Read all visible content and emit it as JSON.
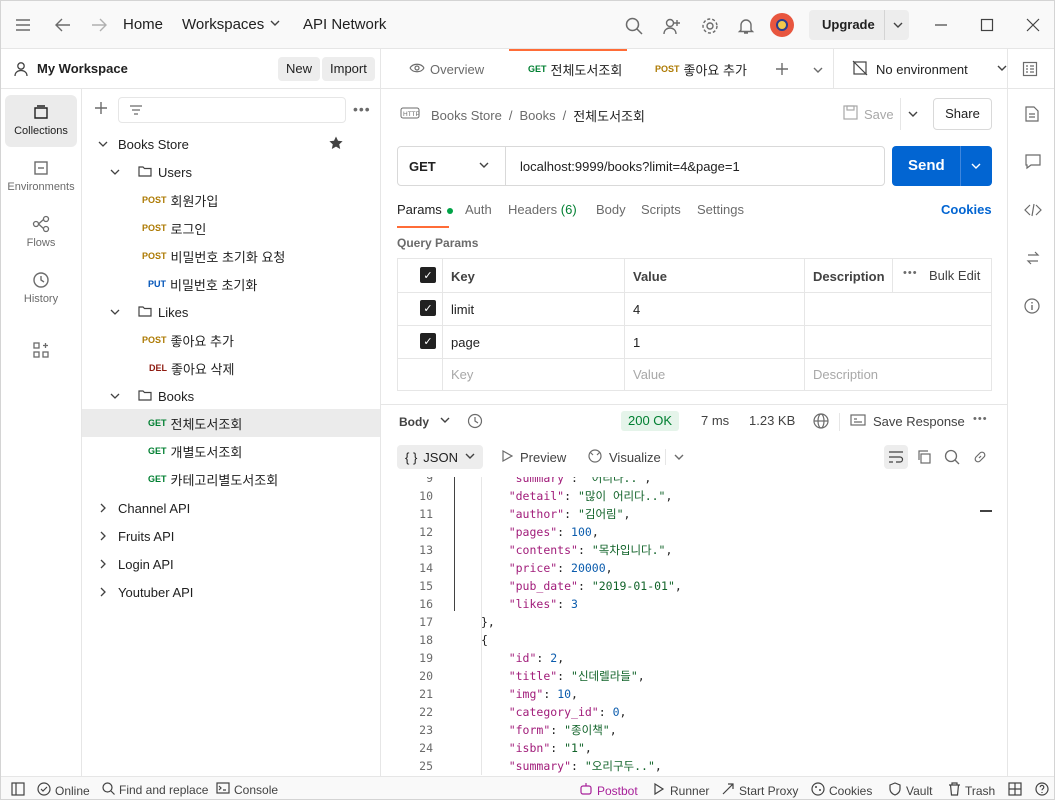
{
  "topbar": {
    "home": "Home",
    "workspaces": "Workspaces",
    "api_network": "API Network",
    "upgrade": "Upgrade"
  },
  "workspace": {
    "name": "My Workspace",
    "new": "New",
    "import": "Import"
  },
  "rail": {
    "items": [
      "Collections",
      "Environments",
      "Flows",
      "History"
    ]
  },
  "tree": {
    "collection": "Books Store",
    "folders": {
      "users": "Users",
      "likes": "Likes",
      "books": "Books"
    },
    "requests": [
      {
        "method": "POST",
        "name": "회원가입"
      },
      {
        "method": "POST",
        "name": "로그인"
      },
      {
        "method": "POST",
        "name": "비밀번호 초기화 요청"
      },
      {
        "method": "PUT",
        "name": "비밀번호 초기화"
      },
      {
        "method": "POST",
        "name": "좋아요 추가"
      },
      {
        "method": "DEL",
        "name": "좋아요 삭제"
      },
      {
        "method": "GET",
        "name": "전체도서조회"
      },
      {
        "method": "GET",
        "name": "개별도서조회"
      },
      {
        "method": "GET",
        "name": "카테고리별도서조회"
      }
    ],
    "other_collections": [
      "Channel API",
      "Fruits API",
      "Login API",
      "Youtuber API"
    ]
  },
  "tabs": {
    "overview": "Overview",
    "tab1_method": "GET",
    "tab1_name": "전체도서조회",
    "tab2_method": "POST",
    "tab2_name": "좋아요 추가",
    "environment": "No environment"
  },
  "request": {
    "breadcrumb": [
      "Books Store",
      "Books",
      "전체도서조회"
    ],
    "save": "Save",
    "share": "Share",
    "method": "GET",
    "url": "localhost:9999/books?limit=4&page=1",
    "send": "Send",
    "subtabs": {
      "params": "Params",
      "auth": "Auth",
      "headers": "Headers",
      "headers_count": "(6)",
      "body": "Body",
      "scripts": "Scripts",
      "settings": "Settings",
      "cookies": "Cookies"
    },
    "query_params_title": "Query Params",
    "columns": {
      "key": "Key",
      "value": "Value",
      "description": "Description",
      "bulk_edit": "Bulk Edit"
    },
    "params": [
      {
        "key": "limit",
        "value": "4"
      },
      {
        "key": "page",
        "value": "1"
      }
    ],
    "placeholders": {
      "key": "Key",
      "value": "Value",
      "description": "Description"
    }
  },
  "response": {
    "body": "Body",
    "status": "200 OK",
    "time": "7 ms",
    "size": "1.23 KB",
    "save_response": "Save Response",
    "format": "JSON",
    "preview": "Preview",
    "visualize": "Visualize",
    "lines": [
      {
        "n": "9",
        "t": "    \"summary\": \"어리다..\","
      },
      {
        "n": "10",
        "t": "    \"detail\": \"많이 어리다..\","
      },
      {
        "n": "11",
        "t": "    \"author\": \"김어림\","
      },
      {
        "n": "12",
        "t": "    \"pages\": 100,"
      },
      {
        "n": "13",
        "t": "    \"contents\": \"목차입니다.\","
      },
      {
        "n": "14",
        "t": "    \"price\": 20000,"
      },
      {
        "n": "15",
        "t": "    \"pub_date\": \"2019-01-01\","
      },
      {
        "n": "16",
        "t": "    \"likes\": 3"
      },
      {
        "n": "17",
        "t": "},"
      },
      {
        "n": "18",
        "t": "{"
      },
      {
        "n": "19",
        "t": "    \"id\": 2,"
      },
      {
        "n": "20",
        "t": "    \"title\": \"신데렐라들\","
      },
      {
        "n": "21",
        "t": "    \"img\": 10,"
      },
      {
        "n": "22",
        "t": "    \"category_id\": 0,"
      },
      {
        "n": "23",
        "t": "    \"form\": \"종이책\","
      },
      {
        "n": "24",
        "t": "    \"isbn\": \"1\","
      },
      {
        "n": "25",
        "t": "    \"summary\": \"오리구두..\","
      }
    ]
  },
  "status": {
    "online": "Online",
    "find_replace": "Find and replace",
    "console": "Console",
    "postbot": "Postbot",
    "runner": "Runner",
    "start_proxy": "Start Proxy",
    "cookies": "Cookies",
    "vault": "Vault",
    "trash": "Trash"
  },
  "colors": {
    "accent": "#0265d2",
    "get": "#007f31",
    "post": "#ad7a03",
    "put": "#0053b8",
    "del": "#8e1a10",
    "postbot": "#a8219a"
  }
}
